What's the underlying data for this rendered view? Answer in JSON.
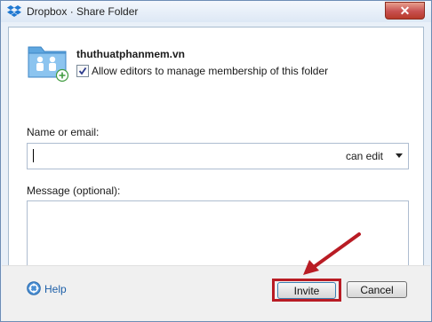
{
  "window": {
    "title": "Dropbox · Share Folder",
    "close_icon": "close-icon",
    "close_glyph": "✕"
  },
  "folder": {
    "icon": "shared-folder-icon",
    "name": "thuthuatphanmem.vn"
  },
  "allow_editors": {
    "checked": true,
    "label": "Allow editors to manage membership of this folder"
  },
  "name_field": {
    "label": "Name or email:",
    "value": "",
    "permission": "can edit"
  },
  "message_field": {
    "label": "Message (optional):",
    "value": ""
  },
  "footer": {
    "help_label": "Help",
    "invite_label": "Invite",
    "cancel_label": "Cancel"
  },
  "colors": {
    "highlight_box": "#b91c24",
    "annotation_arrow": "#b91c24",
    "accent": "#1d5fa8"
  }
}
